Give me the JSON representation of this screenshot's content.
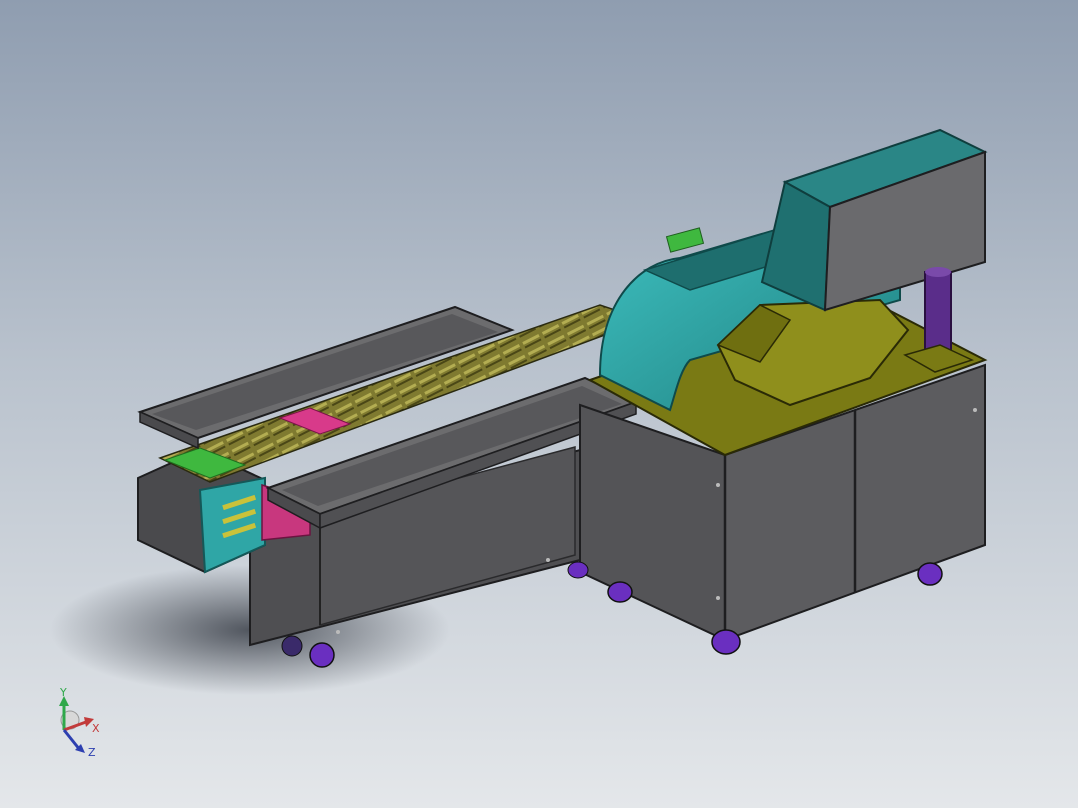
{
  "viewport": {
    "background_top": "#8f9db0",
    "background_bottom": "#e4e7ea"
  },
  "triad": {
    "y_label": "Y",
    "x_label": "X",
    "z_label": "Z",
    "y_color": "#2fa84a",
    "x_color": "#c23a3a",
    "z_color": "#2d3fb0"
  },
  "model": {
    "icon": "conveyor-machine-assembly",
    "colors": {
      "cabinet": "#5a5a5c",
      "frame_edge": "#1e1e20",
      "teal_hood": "#2fa6a6",
      "teal_dark": "#1e6e6e",
      "olive_top": "#7a7a14",
      "olive_motor": "#8f8f1c",
      "purple_column": "#5a2d8a",
      "wheel_purple": "#6a2fc0",
      "conveyor_slat": "#8a8438",
      "green_slat": "#3fb83f",
      "magenta_slat": "#d83a8a",
      "tray_gray": "#6c6c6e"
    }
  }
}
